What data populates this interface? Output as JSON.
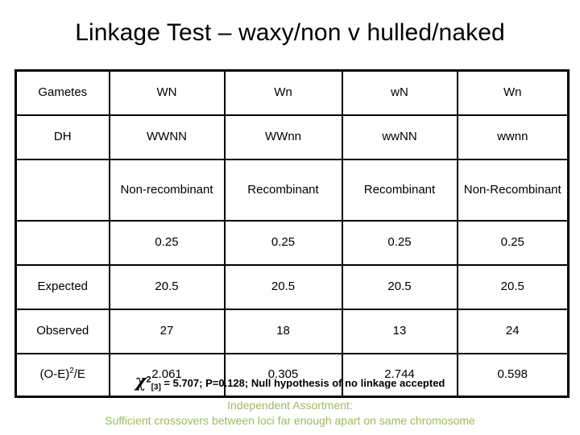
{
  "slide": {
    "title": "Linkage Test – waxy/non v hulled/naked"
  },
  "table": {
    "rows": [
      {
        "label": "Gametes",
        "cells": [
          "WN",
          "Wn",
          "wN",
          "Wn"
        ]
      },
      {
        "label": "DH",
        "cells": [
          "WWNN",
          "WWnn",
          "wwNN",
          "wwnn"
        ]
      },
      {
        "label": "",
        "cells": [
          "Non-recombinant",
          "Recombinant",
          "Recombinant",
          "Non-Recombinant"
        ]
      },
      {
        "label": "",
        "cells": [
          "0.25",
          "0.25",
          "0.25",
          "0.25"
        ]
      },
      {
        "label": "Expected",
        "cells": [
          "20.5",
          "20.5",
          "20.5",
          "20.5"
        ]
      },
      {
        "label": "Observed",
        "cells": [
          "27",
          "18",
          "13",
          "24"
        ]
      },
      {
        "label_prefix": "(O-E)",
        "label_sup": "2",
        "label_suffix": "/E",
        "label": "(O-E)2/E",
        "cells": [
          "2.061",
          "0.305",
          "2.744",
          "0.598"
        ]
      }
    ]
  },
  "footer": {
    "chi_symbol": "χ",
    "chi_sup": "2",
    "chi_sub": "[3]",
    "chi_rest": " = 5.707; P=0.128; Null hypothesis of no linkage accepted",
    "green_line_1": "Independent Assortment:",
    "green_line_2": "Sufficient crossovers between loci far enough apart on same chromosome",
    "green_color": "#9DBB61"
  }
}
